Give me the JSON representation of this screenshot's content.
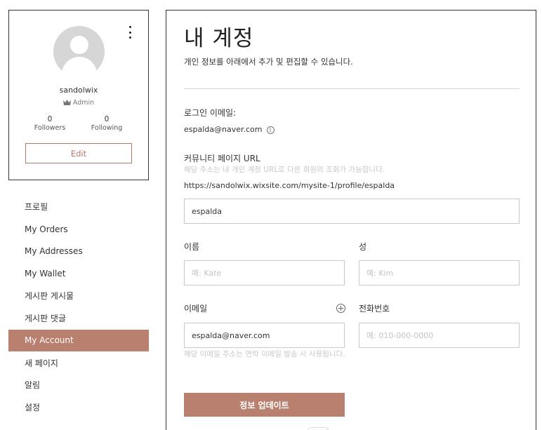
{
  "profile": {
    "username": "sandolwix",
    "role": "Admin",
    "followers_count": "0",
    "followers_label": "Followers",
    "following_count": "0",
    "following_label": "Following",
    "edit_label": "Edit"
  },
  "nav": {
    "items": [
      {
        "label": "프로필"
      },
      {
        "label": "My Orders"
      },
      {
        "label": "My Addresses"
      },
      {
        "label": "My Wallet"
      },
      {
        "label": "게시판 게시물"
      },
      {
        "label": "게시판 댓글"
      },
      {
        "label": "My Account"
      },
      {
        "label": "새 페이지"
      },
      {
        "label": "알림"
      },
      {
        "label": "설정"
      }
    ],
    "active": "My Account"
  },
  "main": {
    "title": "내 계정",
    "subtitle": "개인 정보를 아래에서 추가 및 편집할 수 있습니다.",
    "login_email_label": "로그인 이메일:",
    "login_email_value": "espalda@naver.com",
    "community_url_label": "커뮤니티 페이지 URL",
    "community_url_hint": "해당 주소는 내 개인 계정 URL로 다른 회원의 조회가 가능합니다.",
    "community_url_value": "https://sandolwix.wixsite.com/mysite-1/profile/espalda",
    "slug_value": "espalda",
    "first_name_label": "이름",
    "first_name_placeholder": "예: Kate",
    "last_name_label": "성",
    "last_name_placeholder": "예: Kim",
    "email_label": "이메일",
    "email_value": "espalda@naver.com",
    "email_hint": "해당 이메일 주소는 연락 이메일 발송 시 사용됩니다.",
    "phone_label": "전화번호",
    "phone_placeholder": "예: 010-000-0000",
    "update_button": "정보 업데이트"
  },
  "colors": {
    "accent": "#b9806f",
    "border": "#333333"
  }
}
